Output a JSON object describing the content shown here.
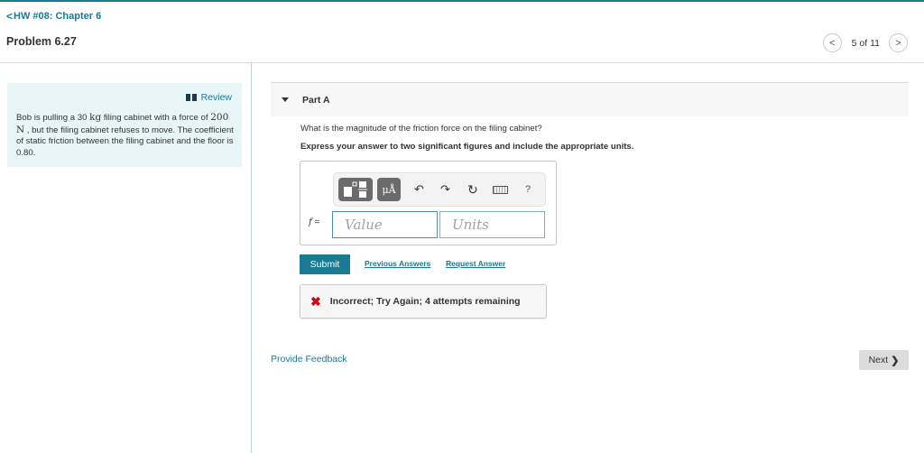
{
  "header": {
    "breadcrumb_label": "HW #08: Chapter 6",
    "breadcrumb_chevron": "<",
    "problem_title": "Problem 6.27",
    "pager": {
      "prev_glyph": "<",
      "count": "5 of 11",
      "next_glyph": ">"
    }
  },
  "sidebar": {
    "review_label": "Review",
    "problem_text": {
      "part1": "Bob is pulling a 30 ",
      "mass_unit": "kg",
      "part2": " filing cabinet with a force of ",
      "force_value": "200 N",
      "part3": " , but the filing cabinet refuses to move. The coefficient of static friction between the filing cabinet and the floor is 0.80."
    }
  },
  "part": {
    "label": "Part A",
    "question": "What is the magnitude of the friction force on the filing cabinet?",
    "instruction": "Express your answer to two significant figures and include the appropriate units.",
    "toolbar": {
      "units_glyph": "μÅ",
      "undo_glyph": "↶",
      "redo_glyph": "↷",
      "reset_glyph": "↻",
      "help_glyph": "?"
    },
    "variable": "f",
    "equals": " =",
    "value_placeholder": "Value",
    "units_placeholder": "Units",
    "value": "",
    "units": ""
  },
  "actions": {
    "submit_label": "Submit",
    "previous_answers_label": "Previous Answers",
    "request_answer_label": "Request Answer"
  },
  "feedback": {
    "icon_glyph": "✖",
    "message": "Incorrect; Try Again; 4 attempts remaining",
    "status_color": "#d0021b"
  },
  "footer": {
    "provide_feedback_label": "Provide Feedback",
    "next_label": "Next",
    "next_glyph": "❯"
  },
  "colors": {
    "accent": "#1a7a94",
    "review_bg": "#e8f6f7"
  }
}
